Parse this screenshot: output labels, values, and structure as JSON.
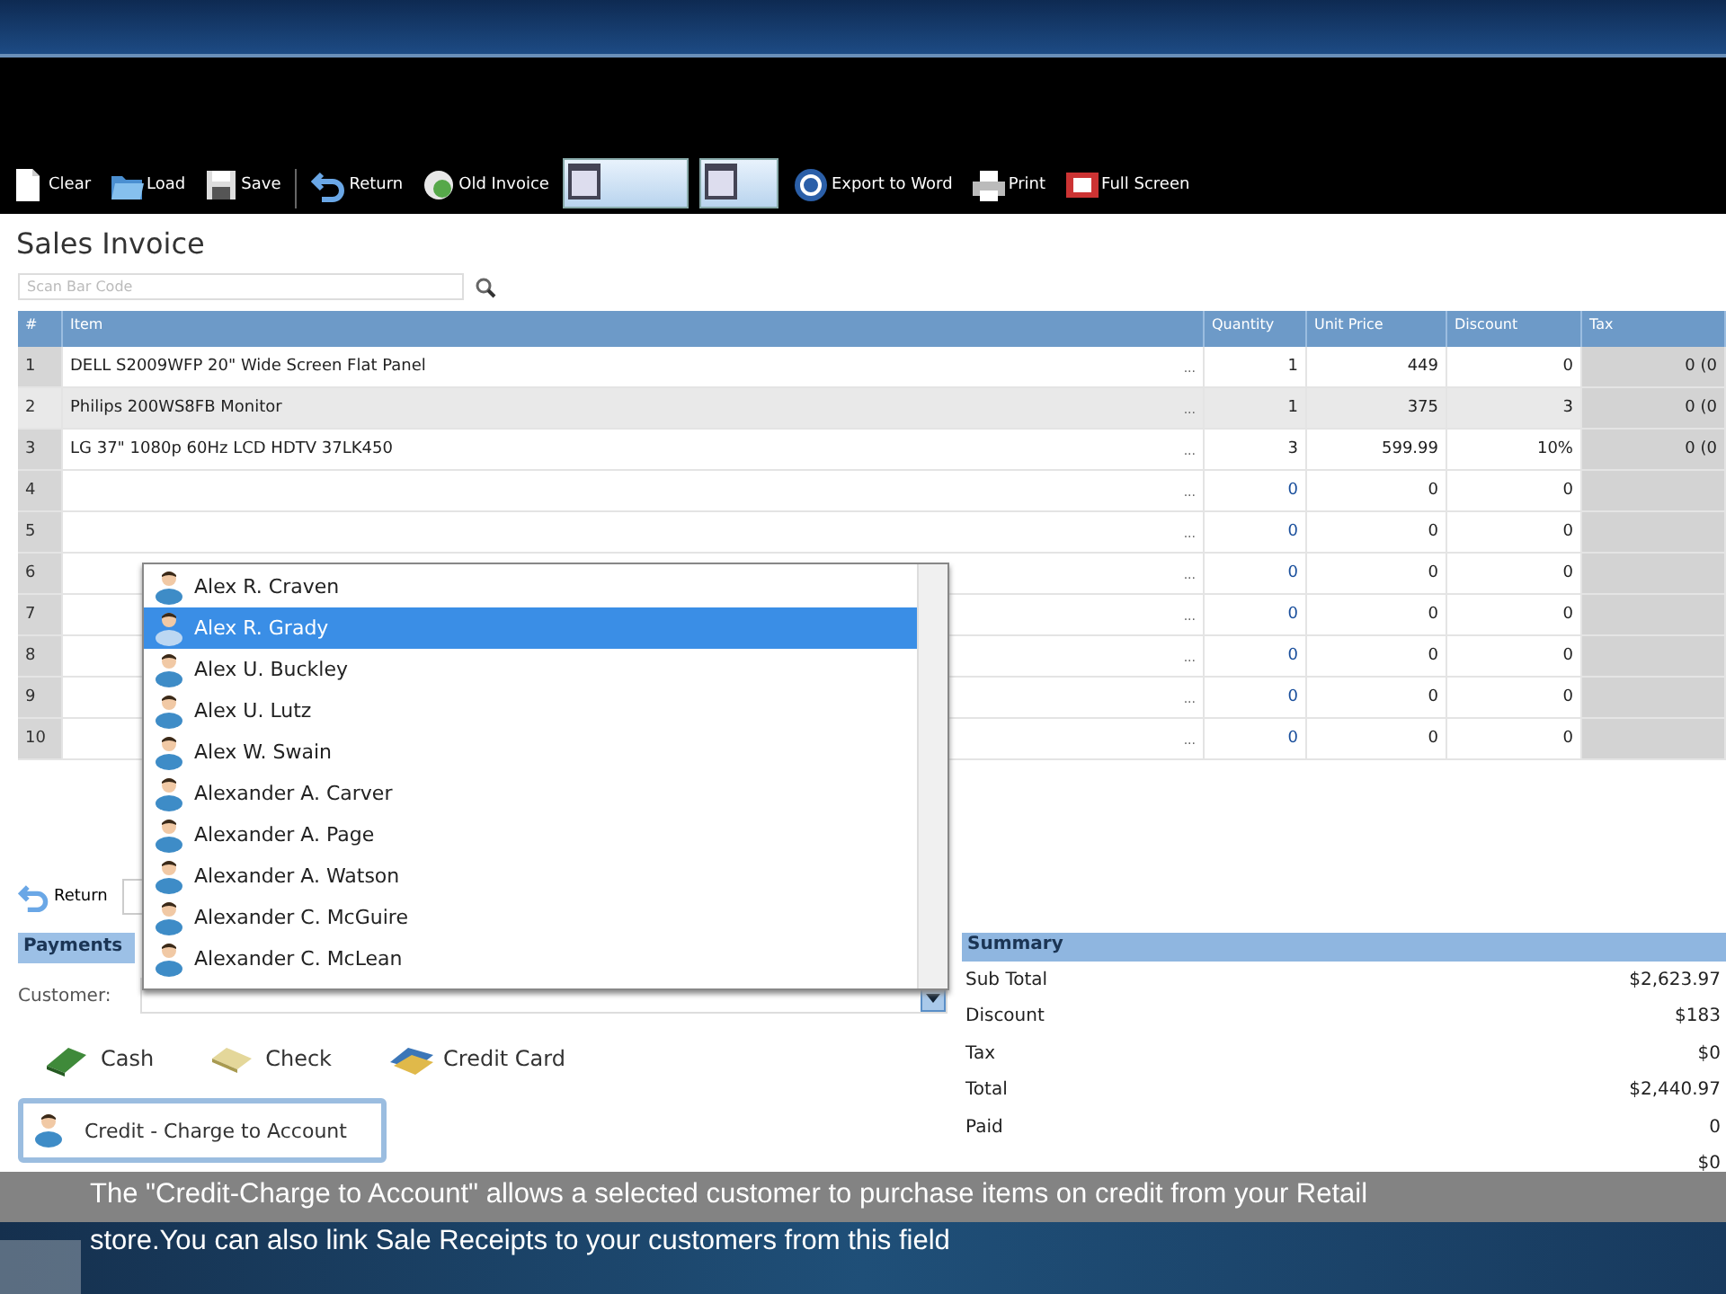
{
  "toolbar": [
    {
      "kind": "button",
      "label": "Clear"
    },
    {
      "kind": "button",
      "label": "Load"
    },
    {
      "kind": "button",
      "label": "Save"
    },
    {
      "kind": "separator"
    },
    {
      "kind": "button",
      "label": "Return"
    },
    {
      "kind": "button",
      "label": "Old Invoice"
    },
    {
      "kind": "layout"
    },
    {
      "kind": "layout"
    },
    {
      "kind": "button",
      "label": "Export to Word"
    },
    {
      "kind": "button",
      "label": "Print"
    },
    {
      "kind": "button",
      "label": "Full Screen"
    }
  ],
  "title": "Sales Invoice",
  "barcode": {
    "placeholder": "Scan Bar Code"
  },
  "table": {
    "columns": [
      "#",
      "Item",
      "Quantity",
      "Unit Price",
      "Discount",
      "Tax"
    ],
    "more": "...",
    "rows": [
      {
        "n": "1",
        "item": "DELL S2009WFP 20\" Wide Screen Flat Panel",
        "qty": "1",
        "price": "449",
        "discount": "0",
        "tax": "0 (0",
        "selected": false
      },
      {
        "n": "2",
        "item": "Philips 200WS8FB Monitor",
        "qty": "1",
        "price": "375",
        "discount": "3",
        "tax": "0 (0",
        "selected": true
      },
      {
        "n": "3",
        "item": "LG 37\" 1080p 60Hz LCD HDTV 37LK450",
        "qty": "3",
        "price": "599.99",
        "discount": "10%",
        "tax": "0 (0",
        "selected": false
      },
      {
        "n": "4",
        "qty": "0",
        "price": "0",
        "discount": "0",
        "selected": false
      },
      {
        "n": "5",
        "qty": "0",
        "price": "0",
        "discount": "0",
        "selected": false
      },
      {
        "n": "6",
        "qty": "0",
        "price": "0",
        "discount": "0",
        "selected": false
      },
      {
        "n": "7",
        "qty": "0",
        "price": "0",
        "discount": "0",
        "selected": false
      },
      {
        "n": "8",
        "qty": "0",
        "price": "0",
        "discount": "0",
        "selected": false
      },
      {
        "n": "9",
        "qty": "0",
        "price": "0",
        "discount": "0",
        "selected": false
      },
      {
        "n": "10",
        "qty": "0",
        "price": "0",
        "discount": "0",
        "selected": false
      }
    ]
  },
  "return_button": "Return",
  "payments": {
    "header": "Payments",
    "customer_label": "Customer:",
    "methods": [
      {
        "label": "Cash"
      },
      {
        "label": "Check"
      },
      {
        "label": "Credit Card"
      }
    ],
    "credit_button": "Credit - Charge to Account"
  },
  "customer_list": [
    {
      "name": "Alex R. Craven",
      "selected": false
    },
    {
      "name": "Alex R. Grady",
      "selected": true
    },
    {
      "name": "Alex U. Buckley",
      "selected": false
    },
    {
      "name": "Alex U. Lutz",
      "selected": false
    },
    {
      "name": "Alex W. Swain",
      "selected": false
    },
    {
      "name": "Alexander A. Carver",
      "selected": false
    },
    {
      "name": "Alexander A. Page",
      "selected": false
    },
    {
      "name": "Alexander A. Watson",
      "selected": false
    },
    {
      "name": "Alexander C. McGuire",
      "selected": false
    },
    {
      "name": "Alexander C. McLean",
      "selected": false
    }
  ],
  "summary": {
    "header": "Summary",
    "rows": [
      {
        "label": "Sub Total",
        "value": "$2,623.97"
      },
      {
        "label": "Discount",
        "value": "$183"
      },
      {
        "label": "Tax",
        "value": "$0"
      },
      {
        "label": "Total",
        "value": "$2,440.97"
      },
      {
        "label": "Paid",
        "value": "0"
      },
      {
        "value": "$0"
      }
    ]
  },
  "caption": [
    "The \"Credit-Charge to Account\" allows a selected customer to purchase items on credit from your Retail",
    "store.You can also link Sale Receipts to your customers from this field"
  ]
}
